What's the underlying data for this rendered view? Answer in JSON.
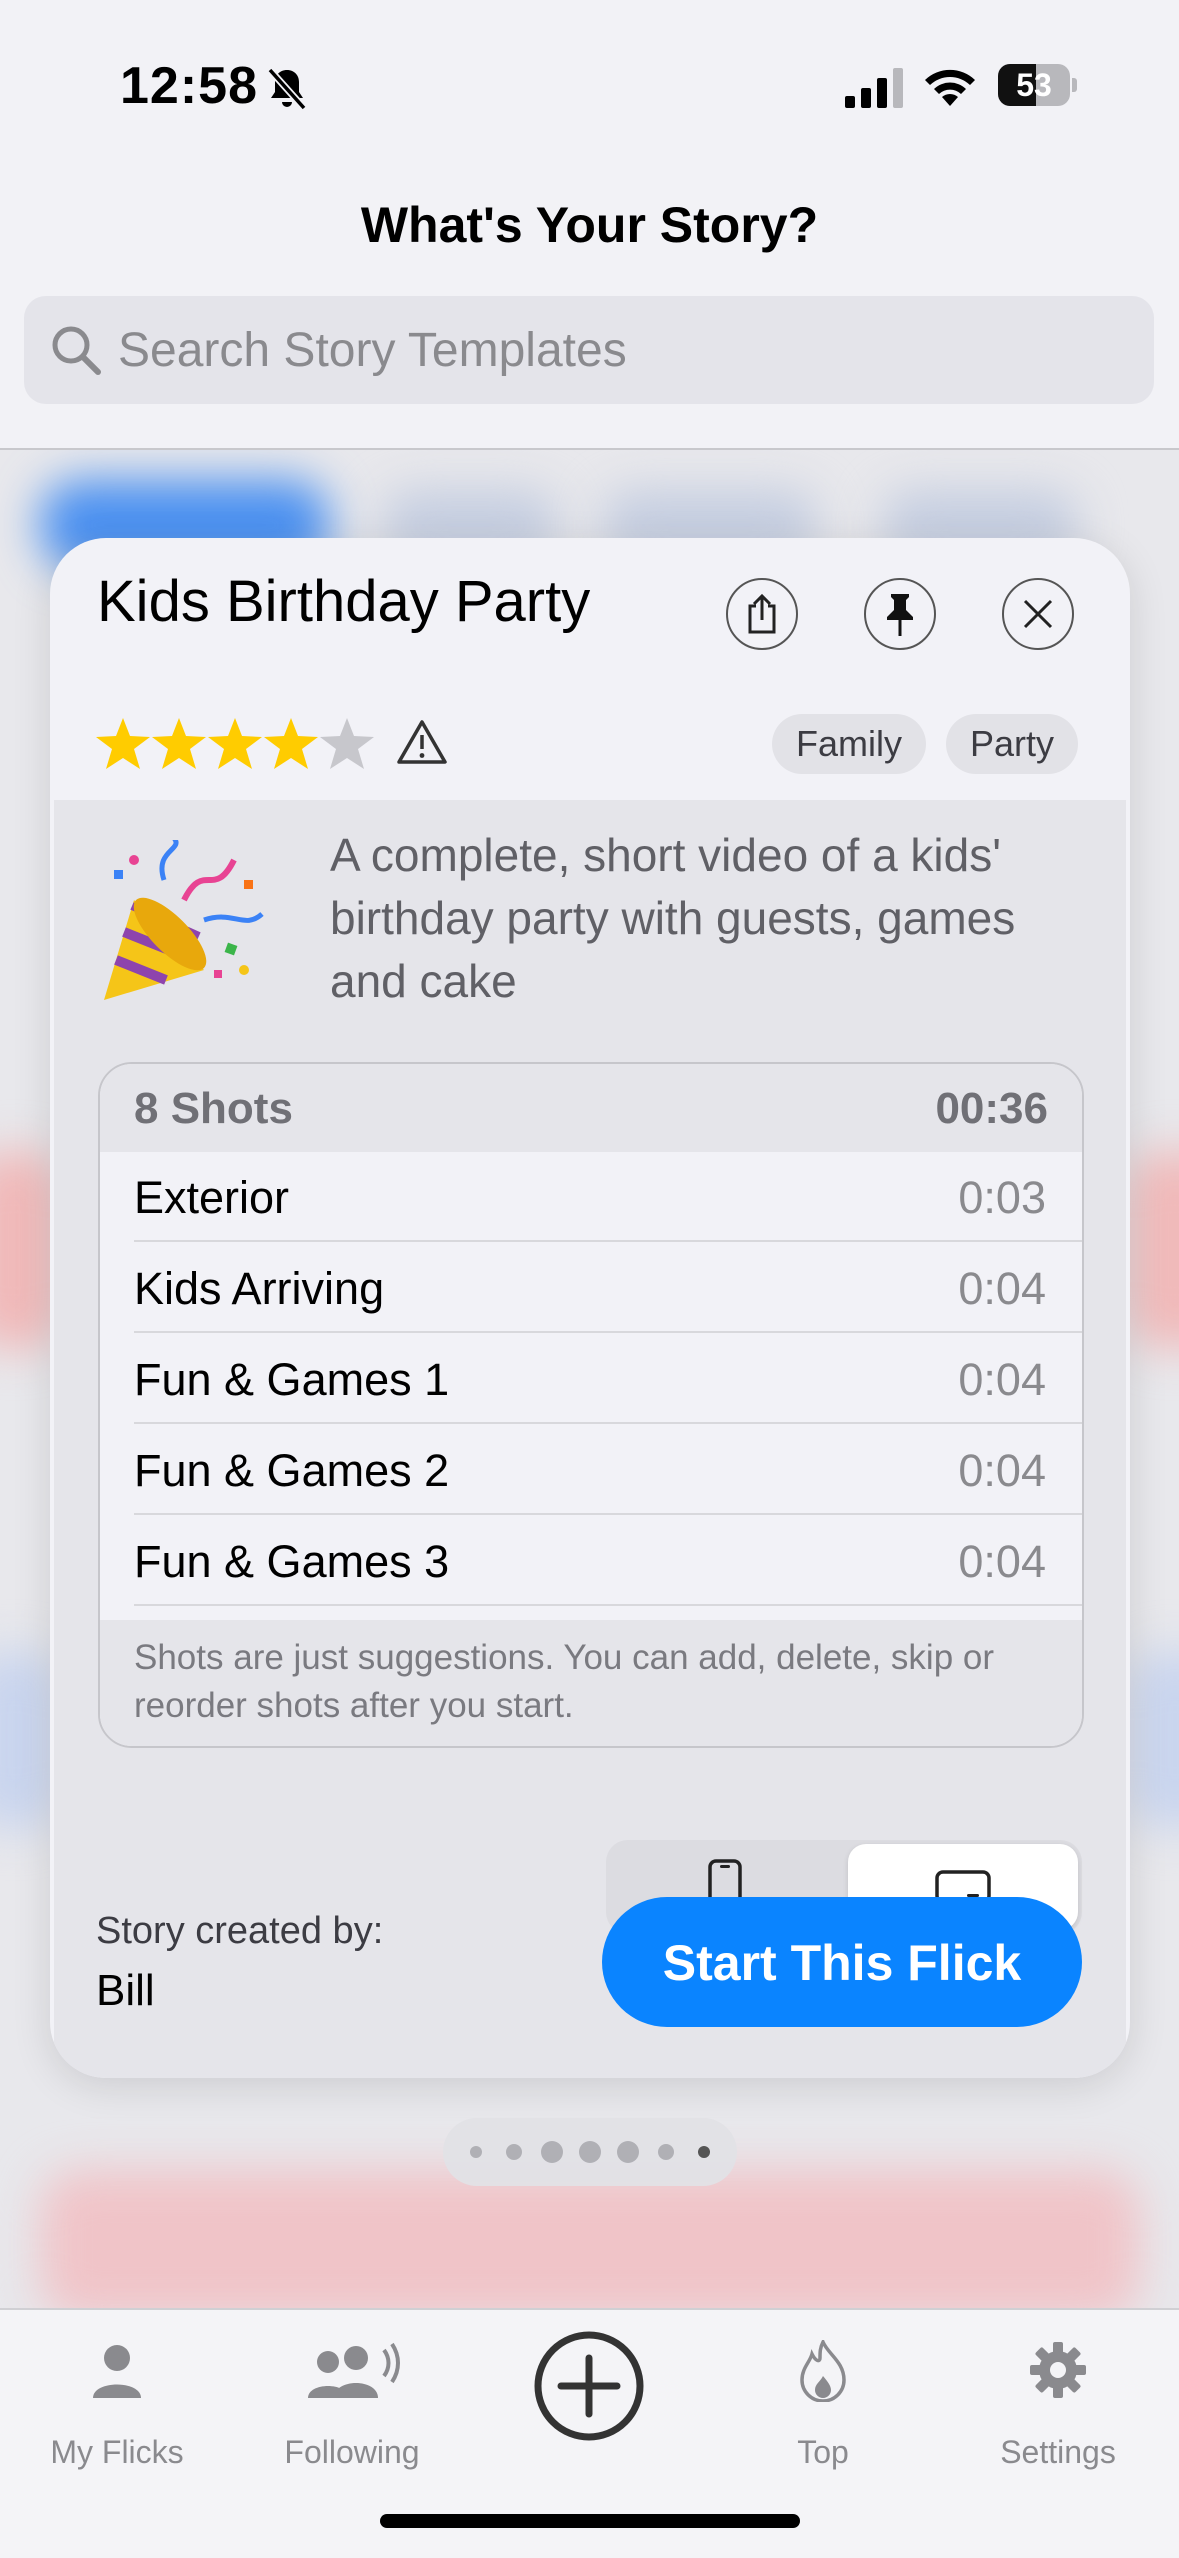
{
  "status_bar": {
    "time": "12:58",
    "battery": "53",
    "battery_level": 0.53
  },
  "header": {
    "title": "What's Your Story?"
  },
  "search": {
    "placeholder": "Search Story Templates"
  },
  "card": {
    "title": "Kids Birthday Party",
    "rating": 4,
    "max_rating": 5,
    "tags": [
      "Family",
      "Party"
    ],
    "description": "A complete, short video of a kids' birthday party with guests, games and cake",
    "shots_header": {
      "count": "8 Shots",
      "total": "00:36"
    },
    "shots": [
      {
        "name": "Exterior",
        "duration": "0:03"
      },
      {
        "name": "Kids Arriving",
        "duration": "0:04"
      },
      {
        "name": "Fun & Games 1",
        "duration": "0:04"
      },
      {
        "name": "Fun & Games 2",
        "duration": "0:04"
      },
      {
        "name": "Fun & Games 3",
        "duration": "0:04"
      }
    ],
    "shots_note": "Shots are just suggestions. You can add, delete, skip or reorder shots after you start.",
    "orientation_selected": "landscape",
    "creator_label": "Story created by:",
    "creator_name": "Bill",
    "start_label": "Start This Flick"
  },
  "page_indicator": {
    "total": 7,
    "current": 7
  },
  "tab_bar": {
    "items": [
      {
        "label": "My Flicks",
        "icon": "person-icon"
      },
      {
        "label": "Following",
        "icon": "people-icon"
      },
      {
        "label": "",
        "icon": "plus-circle-icon"
      },
      {
        "label": "Top",
        "icon": "flame-icon"
      },
      {
        "label": "Settings",
        "icon": "gear-icon"
      }
    ]
  },
  "colors": {
    "accent": "#0a84ff",
    "star": "#ffcc00",
    "star_empty": "#c7c7cc"
  }
}
